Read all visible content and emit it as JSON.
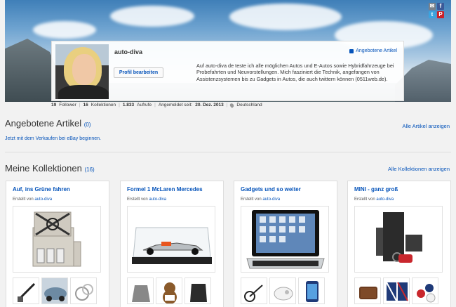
{
  "profile": {
    "username": "auto-diva",
    "edit_button": "Profil bearbeiten",
    "offered_link": "Angebotene Artikel",
    "bio": "Auf auto-diva de teste ich alle möglichen Autos und E-Autos sowie Hybridfahrzeuge bei Probefahrten und Neuvorstellungen. Mich fasziniert die Technik, angefangen von Assistenzsystemen bis zu Gadgets in Autos, die auch twittern können (0511web.de).",
    "social": {
      "mail": "✉",
      "facebook": "f",
      "twitter": "t",
      "pinterest": "P"
    }
  },
  "stats": {
    "followers_value": "19",
    "followers_label": "Follower",
    "collections_value": "16",
    "collections_label": "Kollektionen",
    "views_value": "1.833",
    "views_label": "Aufrufe",
    "member_since_label": "Angemeldet seit:",
    "member_since_value": "20. Dez. 2013",
    "location": "Deutschland"
  },
  "offered": {
    "title": "Angebotene Artikel",
    "count": "(0)",
    "see_all": "Alle Artikel anzeigen",
    "sell_link": "Jetzt mit dem Verkaufen bei eBay beginnen."
  },
  "collections": {
    "title": "Meine Kollektionen",
    "count": "(16)",
    "see_all": "Alle Kollektionen anzeigen",
    "created_by": "Erstellt von",
    "items": [
      {
        "title": "Auf, ins Grüne fahren",
        "author": "auto-diva"
      },
      {
        "title": "Formel 1 McLaren Mercedes",
        "author": "auto-diva"
      },
      {
        "title": "Gadgets und so weiter",
        "author": "auto-diva"
      },
      {
        "title": "MINI - ganz groß",
        "author": "auto-diva"
      }
    ]
  },
  "colors": {
    "link": "#0654ba",
    "background": "#f2f2f2"
  }
}
